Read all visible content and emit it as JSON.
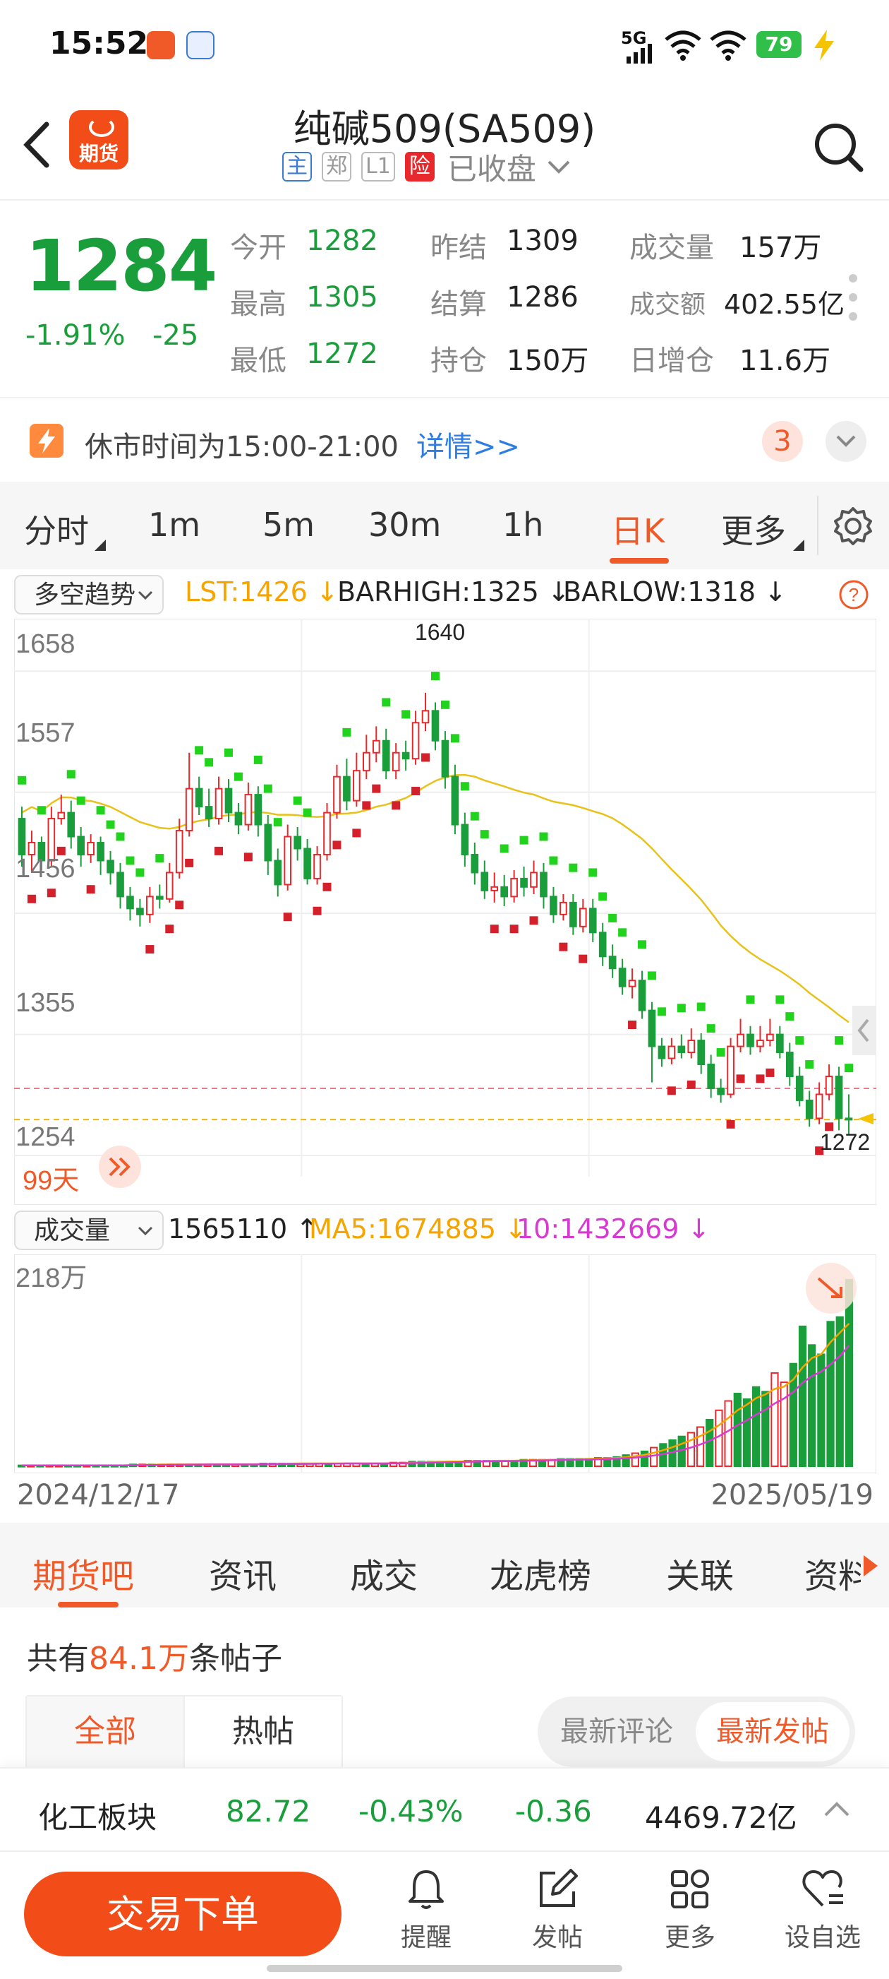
{
  "status_bar": {
    "time": "15:52",
    "network": "5G",
    "battery": "79"
  },
  "header": {
    "badge_label": "期货",
    "title": "纯碱509(SA509)",
    "tags": [
      "主",
      "郑",
      "L1",
      "险"
    ],
    "market_status": "已收盘"
  },
  "quote": {
    "last_price": "1284",
    "change_pct": "-1.91%",
    "change_abs": "-25",
    "fields": [
      {
        "label": "今开",
        "value": "1282",
        "color": "green"
      },
      {
        "label": "昨结",
        "value": "1309",
        "color": "normal"
      },
      {
        "label": "成交量",
        "value": "157万",
        "color": "normal"
      },
      {
        "label": "最高",
        "value": "1305",
        "color": "green"
      },
      {
        "label": "结算",
        "value": "1286",
        "color": "normal"
      },
      {
        "label": "成交额",
        "value": "402.55亿",
        "color": "normal"
      },
      {
        "label": "最低",
        "value": "1272",
        "color": "green"
      },
      {
        "label": "持仓",
        "value": "150万",
        "color": "normal"
      },
      {
        "label": "日增仓",
        "value": "11.6万",
        "color": "normal"
      }
    ]
  },
  "notice": {
    "text": "休市时间为15:00-21:00",
    "link": "详情>>",
    "count": "3"
  },
  "period_tabs": {
    "items": [
      "分时",
      "1m",
      "5m",
      "30m",
      "1h",
      "日K",
      "更多"
    ],
    "active": "日K"
  },
  "indicator": {
    "selector": "多空趋势",
    "lst": "LST:1426",
    "barhigh": "BARHIGH:1325",
    "barlow": "BARLOW:1318"
  },
  "kline": {
    "axis_labels": [
      "1658",
      "1557",
      "1456",
      "1355",
      "1254"
    ],
    "high_label": "1640",
    "low_label": "1272",
    "days_label": "99天"
  },
  "volume_panel": {
    "selector": "成交量",
    "vol": "1565110",
    "ma5": "MA5:1674885",
    "ma10": "10:1432669",
    "max_label": "218万",
    "date_start": "2024/12/17",
    "date_end": "2025/05/19"
  },
  "content_tabs": {
    "items": [
      "期货吧",
      "资讯",
      "成交",
      "龙虎榜",
      "关联",
      "资料"
    ],
    "active": "期货吧"
  },
  "posts": {
    "prefix": "共有",
    "count": "84.1万",
    "suffix": "条帖子",
    "filters": [
      "全部",
      "热帖"
    ],
    "sort": [
      "最新评论",
      "最新发帖"
    ]
  },
  "sector": {
    "name": "化工板块",
    "price": "82.72",
    "pct": "-0.43%",
    "change": "-0.36",
    "amount": "4469.72亿"
  },
  "bottom_nav": {
    "trade_label": "交易下单",
    "items": [
      "提醒",
      "发帖",
      "更多",
      "设自选"
    ]
  },
  "colors": {
    "accent": "#f05a28",
    "up": "#e8282b",
    "down": "#1a9e3c",
    "link": "#2f7de1"
  },
  "chart_data": {
    "type": "candlestick",
    "x_start": "2024/12/17",
    "x_end": "2025/05/19",
    "y_axis_ticks": [
      1658,
      1557,
      1456,
      1355,
      1254
    ],
    "ylim": [
      1254,
      1690
    ],
    "candles": [
      [
        1535,
        1505,
        1545,
        1495
      ],
      [
        1505,
        1515,
        1525,
        1490
      ],
      [
        1515,
        1500,
        1520,
        1492
      ],
      [
        1500,
        1535,
        1545,
        1495
      ],
      [
        1535,
        1540,
        1555,
        1530
      ],
      [
        1540,
        1520,
        1550,
        1510
      ],
      [
        1520,
        1505,
        1528,
        1495
      ],
      [
        1505,
        1515,
        1522,
        1498
      ],
      [
        1515,
        1500,
        1520,
        1488
      ],
      [
        1500,
        1490,
        1508,
        1480
      ],
      [
        1490,
        1470,
        1498,
        1460
      ],
      [
        1470,
        1460,
        1478,
        1450
      ],
      [
        1460,
        1455,
        1468,
        1445
      ],
      [
        1455,
        1470,
        1478,
        1448
      ],
      [
        1470,
        1468,
        1480,
        1460
      ],
      [
        1468,
        1490,
        1498,
        1465
      ],
      [
        1490,
        1525,
        1535,
        1485
      ],
      [
        1525,
        1560,
        1590,
        1520
      ],
      [
        1560,
        1545,
        1570,
        1538
      ],
      [
        1545,
        1535,
        1560,
        1528
      ],
      [
        1535,
        1560,
        1570,
        1530
      ],
      [
        1560,
        1540,
        1568,
        1532
      ],
      [
        1540,
        1530,
        1548,
        1522
      ],
      [
        1530,
        1555,
        1565,
        1525
      ],
      [
        1555,
        1530,
        1562,
        1520
      ],
      [
        1530,
        1500,
        1538,
        1488
      ],
      [
        1500,
        1480,
        1510,
        1470
      ],
      [
        1480,
        1520,
        1530,
        1475
      ],
      [
        1520,
        1510,
        1528,
        1500
      ],
      [
        1510,
        1485,
        1518,
        1480
      ],
      [
        1485,
        1505,
        1512,
        1480
      ],
      [
        1505,
        1540,
        1548,
        1500
      ],
      [
        1540,
        1570,
        1580,
        1535
      ],
      [
        1570,
        1550,
        1585,
        1542
      ],
      [
        1550,
        1575,
        1590,
        1545
      ],
      [
        1575,
        1590,
        1605,
        1568
      ],
      [
        1590,
        1600,
        1612,
        1582
      ],
      [
        1600,
        1575,
        1610,
        1568
      ],
      [
        1575,
        1590,
        1598,
        1568
      ],
      [
        1590,
        1585,
        1600,
        1575
      ],
      [
        1585,
        1615,
        1625,
        1580
      ],
      [
        1615,
        1625,
        1640,
        1608
      ],
      [
        1625,
        1600,
        1632,
        1592
      ],
      [
        1600,
        1570,
        1608,
        1560
      ],
      [
        1570,
        1530,
        1580,
        1522
      ],
      [
        1530,
        1505,
        1540,
        1495
      ],
      [
        1505,
        1490,
        1515,
        1480
      ],
      [
        1490,
        1475,
        1500,
        1468
      ],
      [
        1475,
        1478,
        1490,
        1465
      ],
      [
        1478,
        1470,
        1488,
        1462
      ],
      [
        1470,
        1485,
        1492,
        1465
      ],
      [
        1485,
        1478,
        1495,
        1470
      ],
      [
        1478,
        1490,
        1500,
        1472
      ],
      [
        1490,
        1470,
        1498,
        1460
      ],
      [
        1470,
        1455,
        1478,
        1448
      ],
      [
        1455,
        1465,
        1472,
        1450
      ],
      [
        1465,
        1445,
        1472,
        1438
      ],
      [
        1445,
        1460,
        1468,
        1440
      ],
      [
        1460,
        1440,
        1468,
        1432
      ],
      [
        1440,
        1420,
        1448,
        1412
      ],
      [
        1420,
        1410,
        1430,
        1402
      ],
      [
        1410,
        1395,
        1418,
        1388
      ],
      [
        1395,
        1400,
        1410,
        1385
      ],
      [
        1400,
        1375,
        1408,
        1368
      ],
      [
        1375,
        1345,
        1382,
        1315
      ],
      [
        1345,
        1335,
        1352,
        1328
      ],
      [
        1335,
        1345,
        1352,
        1330
      ],
      [
        1345,
        1340,
        1355,
        1335
      ],
      [
        1340,
        1350,
        1360,
        1335
      ],
      [
        1350,
        1330,
        1356,
        1322
      ],
      [
        1330,
        1310,
        1338,
        1302
      ],
      [
        1310,
        1305,
        1318,
        1298
      ],
      [
        1305,
        1345,
        1352,
        1302
      ],
      [
        1345,
        1355,
        1368,
        1340
      ],
      [
        1355,
        1345,
        1362,
        1338
      ],
      [
        1345,
        1350,
        1362,
        1340
      ],
      [
        1350,
        1355,
        1368,
        1345
      ],
      [
        1355,
        1340,
        1362,
        1335
      ],
      [
        1340,
        1320,
        1348,
        1312
      ],
      [
        1320,
        1300,
        1328,
        1295
      ],
      [
        1300,
        1285,
        1308,
        1278
      ],
      [
        1285,
        1305,
        1315,
        1280
      ],
      [
        1305,
        1320,
        1330,
        1300
      ],
      [
        1320,
        1285,
        1328,
        1275
      ],
      [
        1285,
        1284,
        1305,
        1272
      ]
    ],
    "volume_max_label": "218万",
    "volumes": [
      1,
      1,
      1,
      1,
      1,
      1,
      1,
      1,
      1,
      1,
      1,
      1,
      2,
      2,
      2,
      2,
      2,
      2,
      2,
      2,
      2,
      2,
      2,
      2,
      2,
      2,
      3,
      3,
      3,
      3,
      3,
      3,
      3,
      3,
      3,
      3,
      3,
      3,
      3,
      3,
      4,
      4,
      5,
      5,
      5,
      5,
      5,
      5,
      6,
      6,
      6,
      6,
      6,
      6,
      7,
      7,
      7,
      7,
      8,
      8,
      8,
      8,
      9,
      9,
      10,
      12,
      14,
      16,
      20,
      24,
      28,
      32,
      36,
      42,
      50,
      60,
      70,
      78,
      72,
      85,
      80,
      100,
      90,
      110,
      150,
      130,
      120,
      155,
      160,
      200
    ]
  }
}
